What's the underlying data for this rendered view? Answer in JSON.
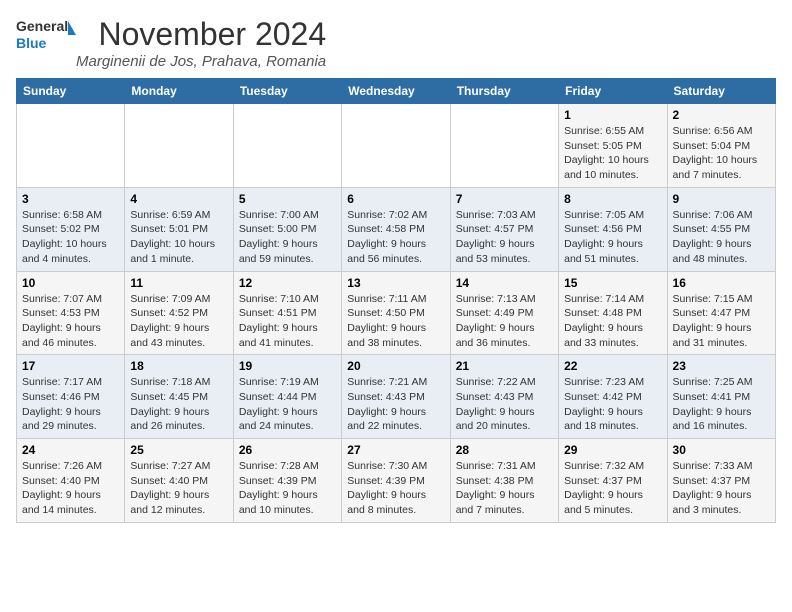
{
  "header": {
    "logo_general": "General",
    "logo_blue": "Blue",
    "month_title": "November 2024",
    "location": "Marginenii de Jos, Prahava, Romania"
  },
  "weekdays": [
    "Sunday",
    "Monday",
    "Tuesday",
    "Wednesday",
    "Thursday",
    "Friday",
    "Saturday"
  ],
  "weeks": [
    [
      {
        "day": "",
        "info": ""
      },
      {
        "day": "",
        "info": ""
      },
      {
        "day": "",
        "info": ""
      },
      {
        "day": "",
        "info": ""
      },
      {
        "day": "",
        "info": ""
      },
      {
        "day": "1",
        "info": "Sunrise: 6:55 AM\nSunset: 5:05 PM\nDaylight: 10 hours and 10 minutes."
      },
      {
        "day": "2",
        "info": "Sunrise: 6:56 AM\nSunset: 5:04 PM\nDaylight: 10 hours and 7 minutes."
      }
    ],
    [
      {
        "day": "3",
        "info": "Sunrise: 6:58 AM\nSunset: 5:02 PM\nDaylight: 10 hours and 4 minutes."
      },
      {
        "day": "4",
        "info": "Sunrise: 6:59 AM\nSunset: 5:01 PM\nDaylight: 10 hours and 1 minute."
      },
      {
        "day": "5",
        "info": "Sunrise: 7:00 AM\nSunset: 5:00 PM\nDaylight: 9 hours and 59 minutes."
      },
      {
        "day": "6",
        "info": "Sunrise: 7:02 AM\nSunset: 4:58 PM\nDaylight: 9 hours and 56 minutes."
      },
      {
        "day": "7",
        "info": "Sunrise: 7:03 AM\nSunset: 4:57 PM\nDaylight: 9 hours and 53 minutes."
      },
      {
        "day": "8",
        "info": "Sunrise: 7:05 AM\nSunset: 4:56 PM\nDaylight: 9 hours and 51 minutes."
      },
      {
        "day": "9",
        "info": "Sunrise: 7:06 AM\nSunset: 4:55 PM\nDaylight: 9 hours and 48 minutes."
      }
    ],
    [
      {
        "day": "10",
        "info": "Sunrise: 7:07 AM\nSunset: 4:53 PM\nDaylight: 9 hours and 46 minutes."
      },
      {
        "day": "11",
        "info": "Sunrise: 7:09 AM\nSunset: 4:52 PM\nDaylight: 9 hours and 43 minutes."
      },
      {
        "day": "12",
        "info": "Sunrise: 7:10 AM\nSunset: 4:51 PM\nDaylight: 9 hours and 41 minutes."
      },
      {
        "day": "13",
        "info": "Sunrise: 7:11 AM\nSunset: 4:50 PM\nDaylight: 9 hours and 38 minutes."
      },
      {
        "day": "14",
        "info": "Sunrise: 7:13 AM\nSunset: 4:49 PM\nDaylight: 9 hours and 36 minutes."
      },
      {
        "day": "15",
        "info": "Sunrise: 7:14 AM\nSunset: 4:48 PM\nDaylight: 9 hours and 33 minutes."
      },
      {
        "day": "16",
        "info": "Sunrise: 7:15 AM\nSunset: 4:47 PM\nDaylight: 9 hours and 31 minutes."
      }
    ],
    [
      {
        "day": "17",
        "info": "Sunrise: 7:17 AM\nSunset: 4:46 PM\nDaylight: 9 hours and 29 minutes."
      },
      {
        "day": "18",
        "info": "Sunrise: 7:18 AM\nSunset: 4:45 PM\nDaylight: 9 hours and 26 minutes."
      },
      {
        "day": "19",
        "info": "Sunrise: 7:19 AM\nSunset: 4:44 PM\nDaylight: 9 hours and 24 minutes."
      },
      {
        "day": "20",
        "info": "Sunrise: 7:21 AM\nSunset: 4:43 PM\nDaylight: 9 hours and 22 minutes."
      },
      {
        "day": "21",
        "info": "Sunrise: 7:22 AM\nSunset: 4:43 PM\nDaylight: 9 hours and 20 minutes."
      },
      {
        "day": "22",
        "info": "Sunrise: 7:23 AM\nSunset: 4:42 PM\nDaylight: 9 hours and 18 minutes."
      },
      {
        "day": "23",
        "info": "Sunrise: 7:25 AM\nSunset: 4:41 PM\nDaylight: 9 hours and 16 minutes."
      }
    ],
    [
      {
        "day": "24",
        "info": "Sunrise: 7:26 AM\nSunset: 4:40 PM\nDaylight: 9 hours and 14 minutes."
      },
      {
        "day": "25",
        "info": "Sunrise: 7:27 AM\nSunset: 4:40 PM\nDaylight: 9 hours and 12 minutes."
      },
      {
        "day": "26",
        "info": "Sunrise: 7:28 AM\nSunset: 4:39 PM\nDaylight: 9 hours and 10 minutes."
      },
      {
        "day": "27",
        "info": "Sunrise: 7:30 AM\nSunset: 4:39 PM\nDaylight: 9 hours and 8 minutes."
      },
      {
        "day": "28",
        "info": "Sunrise: 7:31 AM\nSunset: 4:38 PM\nDaylight: 9 hours and 7 minutes."
      },
      {
        "day": "29",
        "info": "Sunrise: 7:32 AM\nSunset: 4:37 PM\nDaylight: 9 hours and 5 minutes."
      },
      {
        "day": "30",
        "info": "Sunrise: 7:33 AM\nSunset: 4:37 PM\nDaylight: 9 hours and 3 minutes."
      }
    ]
  ]
}
